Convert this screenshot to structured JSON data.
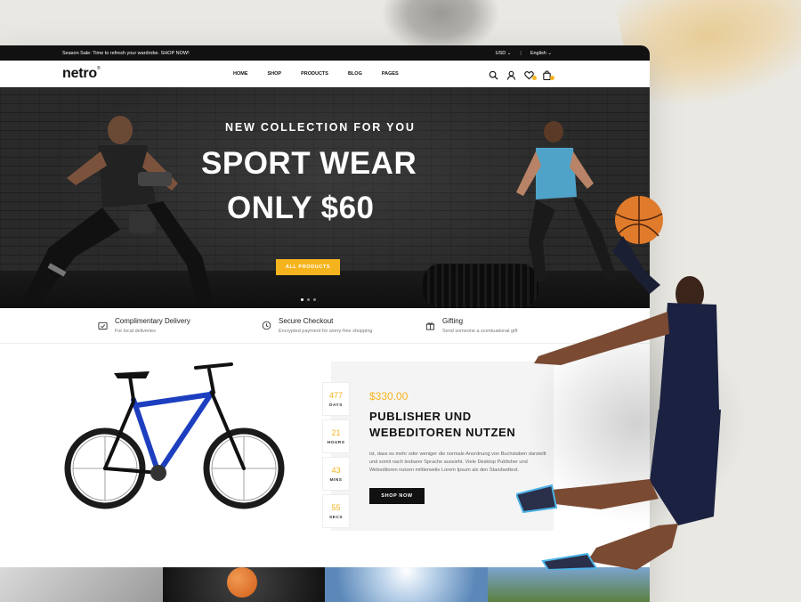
{
  "announcement": {
    "text": "Season Sale: Time to refresh your wardrobe. SHOP NOW!",
    "currency": "USD",
    "language": "English"
  },
  "brand": {
    "logo": "netro"
  },
  "nav": {
    "items": [
      "HOME",
      "SHOP",
      "PRODUCTS",
      "BLOG",
      "PAGES"
    ],
    "icons": [
      "search-icon",
      "user-icon",
      "heart-icon",
      "bag-icon"
    ]
  },
  "hero": {
    "eyebrow": "NEW COLLECTION FOR YOU",
    "headline_line1": "SPORT WEAR",
    "headline_line2": "ONLY $60",
    "button": "ALL PRODUCTS",
    "slides": 3,
    "active_slide": 1
  },
  "features": [
    {
      "title": "Complimentary Delivery",
      "sub": "For local deliveries",
      "icon": "delivery-icon"
    },
    {
      "title": "Secure Checkout",
      "sub": "Encrypted payment for worry-free shopping",
      "icon": "secure-icon"
    },
    {
      "title": "Gifting",
      "sub": "Send someone a scentuational gift",
      "icon": "gift-icon"
    }
  ],
  "product": {
    "price": "$330.00",
    "title_line1": "PUBLISHER UND",
    "title_line2": "WEBEDITOREN NUTZEN",
    "description": "ist, dass es mehr oder weniger die normale Anordnung von Buchstaben darstellt und somit nach lesbarer Sprache aussieht. Viele Desktop Publisher und Webeditoren nutzen mittlerweile Lorem Ipsum als den Standardtext.",
    "button": "SHOP NOW",
    "countdown": [
      {
        "value": "477",
        "label": "DAYS"
      },
      {
        "value": "21",
        "label": "HOURS"
      },
      {
        "value": "43",
        "label": "MINS"
      },
      {
        "value": "55",
        "label": "SECS"
      }
    ]
  },
  "colors": {
    "accent": "#f5b41e",
    "dark": "#111111",
    "panel": "#f4f4f4"
  }
}
